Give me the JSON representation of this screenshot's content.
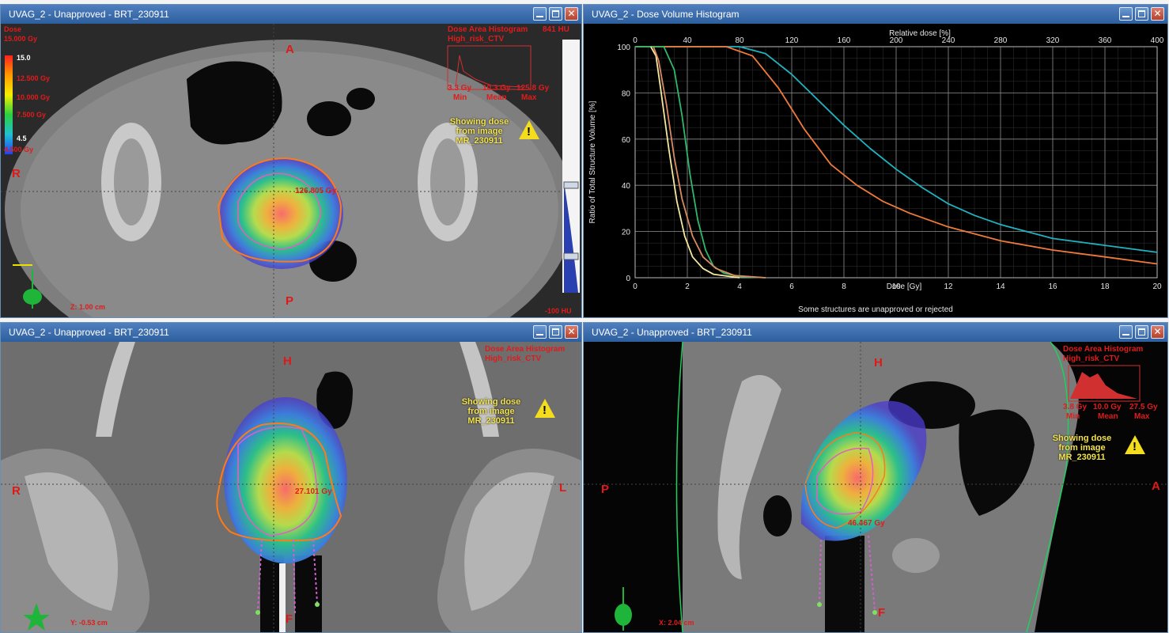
{
  "windows": {
    "axial": {
      "title": "UVAG_2  -  Unapproved  -  BRT_230911",
      "orient": {
        "top": "A",
        "bottom": "P",
        "left": "R"
      },
      "dose_area_histogram": {
        "title": "Dose Area Histogram",
        "structure": "High_risk_CTV",
        "hu": "841 HU",
        "min_val": "3.3 Gy",
        "mean_val": "10.3 Gy",
        "max_val": "125.8 Gy",
        "min_lbl": "Min",
        "mean_lbl": "Mean",
        "max_lbl": "Max"
      },
      "showing": [
        "Showing dose",
        "from image",
        "MR_230911"
      ],
      "dose_legend": {
        "title": "Dose",
        "max": "15.000 Gy",
        "top_val": "15.0",
        "v1": "12.500 Gy",
        "v2": "10.000 Gy",
        "v3": "7.500 Gy",
        "low_val": "4.5",
        "min": "4.500 Gy"
      },
      "point_dose": "126.805 Gy",
      "coord": "Z: 1.00 cm",
      "hu_low": "-100 HU"
    },
    "dvh": {
      "title": "UVAG_2  -  Dose Volume Histogram",
      "footer": "Some structures are unapproved or rejected"
    },
    "coronal": {
      "title": "UVAG_2  -  Unapproved  -  BRT_230911",
      "orient": {
        "top": "H",
        "bottom": "F",
        "left": "R",
        "right": "L"
      },
      "dose_area_histogram": {
        "title": "Dose Area Histogram",
        "structure": "High_risk_CTV"
      },
      "showing": [
        "Showing dose",
        "from image",
        "MR_230911"
      ],
      "point_dose": "27.101 Gy",
      "coord": "Y: -0.53 cm"
    },
    "sagittal": {
      "title": "UVAG_2  -  Unapproved  -  BRT_230911",
      "orient": {
        "top": "H",
        "bottom": "F",
        "left": "P",
        "right": "A"
      },
      "dose_area_histogram": {
        "title": "Dose Area Histogram",
        "structure": "High_risk_CTV",
        "min_val": "3.8 Gy",
        "mean_val": "10.0 Gy",
        "max_val": "27.5 Gy",
        "min_lbl": "Min",
        "mean_lbl": "Mean",
        "max_lbl": "Max"
      },
      "showing": [
        "Showing dose",
        "from image",
        "MR_230911"
      ],
      "point_dose": "46.467 Gy",
      "coord": "X: 2.04 cm"
    }
  },
  "colors": {
    "bg": "#000000",
    "titlebar": "#3b6cae",
    "red_text": "#e11b1b",
    "yellow_text": "#f3e34a",
    "cyan_curve": "#1fb3c0",
    "orange_curve": "#f07a3a"
  },
  "chart_data": {
    "type": "line",
    "title": "",
    "xlabel": "Dose [Gy]",
    "ylabel": "Ratio of Total Structure Volume [%]",
    "x2label": "Relative dose [%]",
    "xlim": [
      0,
      20
    ],
    "ylim": [
      0,
      100
    ],
    "x2lim": [
      0,
      400
    ],
    "xticks": [
      0,
      2,
      4,
      6,
      8,
      10,
      12,
      14,
      16,
      18,
      20
    ],
    "yticks": [
      0,
      20,
      40,
      60,
      80,
      100
    ],
    "x2ticks": [
      0,
      40,
      80,
      120,
      160,
      200,
      240,
      280,
      320,
      360,
      400
    ],
    "grid": true,
    "series": [
      {
        "color": "#1fb3c0",
        "x": [
          0,
          4,
          5,
          6,
          7,
          8,
          9,
          10,
          11,
          12,
          13,
          14,
          16,
          18,
          20
        ],
        "y": [
          100,
          100,
          97,
          88,
          77,
          66,
          56,
          47,
          39,
          32,
          27,
          23,
          17,
          14,
          11
        ]
      },
      {
        "color": "#f07a3a",
        "x": [
          0,
          3.5,
          4.5,
          5.5,
          6.5,
          7.5,
          8.5,
          9.5,
          10.5,
          12,
          14,
          16,
          18,
          20
        ],
        "y": [
          100,
          100,
          96,
          82,
          64,
          49,
          40,
          33,
          28,
          22,
          16,
          12,
          9,
          6
        ]
      },
      {
        "color": "#2fb86a",
        "x": [
          0,
          1.1,
          1.5,
          1.8,
          2.1,
          2.4,
          2.7,
          3.0,
          3.4,
          4.0,
          5.0
        ],
        "y": [
          100,
          100,
          90,
          70,
          45,
          25,
          12,
          5,
          2,
          0.5,
          0
        ]
      },
      {
        "color": "#f5e8a0",
        "x": [
          0.6,
          0.8,
          1.0,
          1.3,
          1.6,
          1.9,
          2.2,
          2.6,
          3.0,
          4.0
        ],
        "y": [
          100,
          96,
          80,
          55,
          33,
          18,
          9,
          4,
          1.5,
          0
        ]
      },
      {
        "color": "#d88a60",
        "x": [
          0.7,
          0.9,
          1.2,
          1.5,
          1.8,
          2.2,
          2.6,
          3.1,
          3.8,
          5.0
        ],
        "y": [
          100,
          94,
          75,
          52,
          34,
          18,
          9,
          4,
          1,
          0
        ]
      }
    ]
  }
}
